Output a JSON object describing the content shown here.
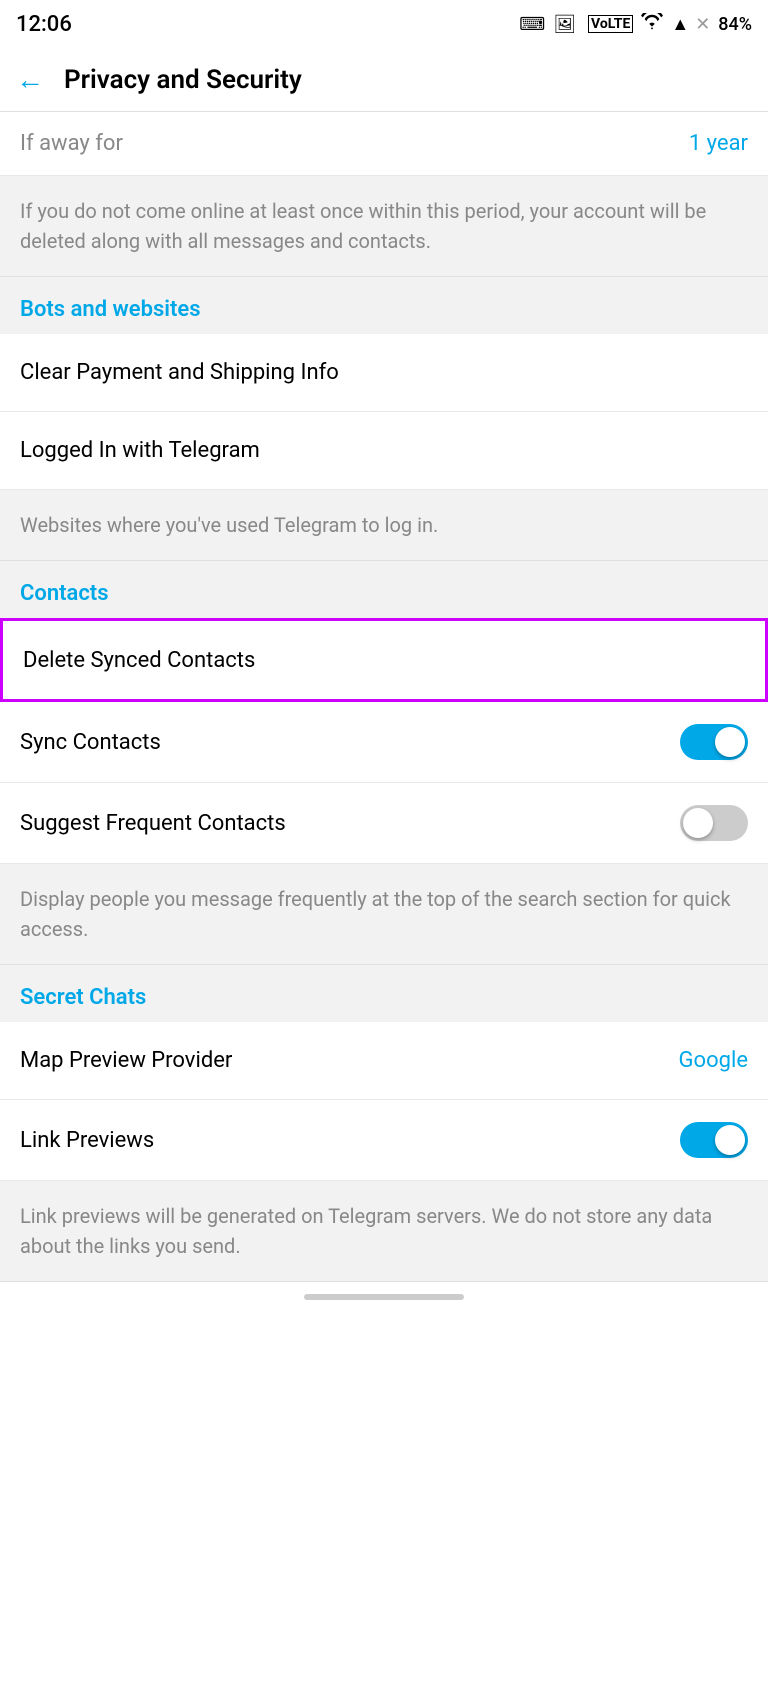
{
  "statusBar": {
    "time": "12:06",
    "battery": "84%"
  },
  "header": {
    "backLabel": "←",
    "title": "Privacy and Security"
  },
  "partialTop": {
    "label": "If away for",
    "value": "1 year"
  },
  "infoBlock1": {
    "text": "If you do not come online at least once within this period, your account will be deleted along with all messages and contacts."
  },
  "sections": {
    "botsAndWebsites": {
      "heading": "Bots and websites",
      "items": [
        {
          "label": "Clear Payment and Shipping Info",
          "value": ""
        },
        {
          "label": "Logged In with Telegram",
          "value": ""
        }
      ],
      "infoText": "Websites where you've used Telegram to log in."
    },
    "contacts": {
      "heading": "Contacts",
      "items": [
        {
          "label": "Delete Synced Contacts",
          "highlighted": true
        },
        {
          "label": "Sync Contacts",
          "toggle": true,
          "toggleState": "on"
        },
        {
          "label": "Suggest Frequent Contacts",
          "toggle": true,
          "toggleState": "off"
        }
      ],
      "infoText": "Display people you message frequently at the top of the search section for quick access."
    },
    "secretChats": {
      "heading": "Secret Chats",
      "items": [
        {
          "label": "Map Preview Provider",
          "value": "Google"
        },
        {
          "label": "Link Previews",
          "toggle": true,
          "toggleState": "on"
        }
      ],
      "infoText": "Link previews will be generated on Telegram servers. We do not store any data about the links you send."
    }
  }
}
